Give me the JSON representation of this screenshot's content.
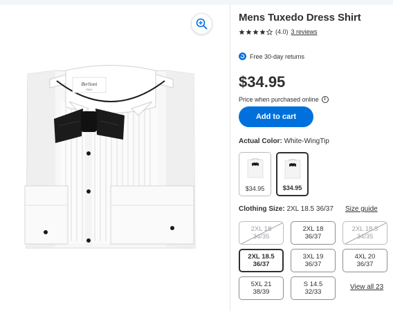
{
  "product": {
    "title": "Mens Tuxedo Dress Shirt",
    "rating_value": "(4.0)",
    "rating_stars": 4,
    "reviews_link": "3 reviews",
    "collar_label_brand": "Berlioni",
    "collar_label_sub": "ITALY"
  },
  "returns": {
    "text": "Free 30-day returns"
  },
  "pricing": {
    "price": "$34.95",
    "online_note": "Price when purchased online",
    "info_glyph": "i"
  },
  "actions": {
    "add_to_cart": "Add to cart"
  },
  "color": {
    "label": "Actual Color:",
    "value": "White-WingTip",
    "swatches": [
      {
        "price": "$34.95",
        "selected": false
      },
      {
        "price": "$34.95",
        "selected": true
      }
    ]
  },
  "size": {
    "label": "Clothing Size:",
    "value": "2XL 18.5 36/37",
    "guide_link": "Size guide",
    "options": [
      {
        "line1": "2XL 18",
        "line2": "34/35",
        "state": "unavailable"
      },
      {
        "line1": "2XL 18",
        "line2": "36/37",
        "state": "available"
      },
      {
        "line1": "2XL 18.5",
        "line2": "34/35",
        "state": "unavailable"
      },
      {
        "line1": "2XL 18.5",
        "line2": "36/37",
        "state": "selected"
      },
      {
        "line1": "3XL 19",
        "line2": "36/37",
        "state": "available"
      },
      {
        "line1": "4XL 20",
        "line2": "36/37",
        "state": "available"
      },
      {
        "line1": "5XL 21",
        "line2": "38/39",
        "state": "available"
      },
      {
        "line1": "S 14.5",
        "line2": "32/33",
        "state": "available"
      }
    ],
    "view_all": "View all 23"
  },
  "colors": {
    "accent": "#0071dc",
    "text": "#2e2f32",
    "muted": "#9ea0a4"
  }
}
